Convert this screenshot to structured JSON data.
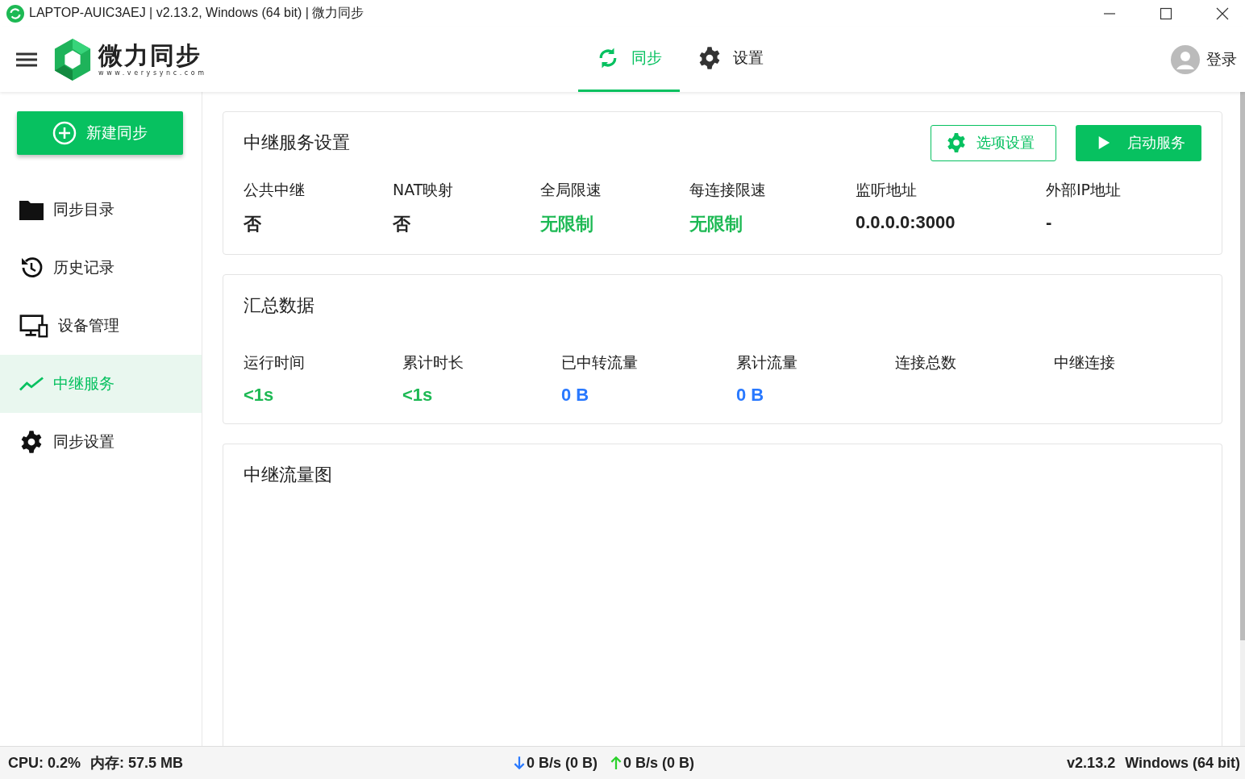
{
  "window": {
    "title": "LAPTOP-AUIC3AEJ | v2.13.2, Windows (64 bit) | 微力同步"
  },
  "logo": {
    "name": "微力同步",
    "url": "www.verysync.com"
  },
  "tabs": [
    {
      "label": "同步",
      "kind": "sync",
      "selected": true
    },
    {
      "label": "设置",
      "kind": "gear",
      "selected": false
    }
  ],
  "login": "登录",
  "new_button": "新建同步",
  "sidebar": [
    {
      "label": "同步目录",
      "kind": "folder",
      "selected": false
    },
    {
      "label": "历史记录",
      "kind": "history",
      "selected": false
    },
    {
      "label": "设备管理",
      "kind": "device",
      "selected": false
    },
    {
      "label": "中继服务",
      "kind": "chart",
      "selected": true
    },
    {
      "label": "同步设置",
      "kind": "gear",
      "selected": false
    }
  ],
  "relay_settings": {
    "title": "中继服务设置",
    "buttons": [
      {
        "label": "选项设置",
        "kind": "outline"
      },
      {
        "label": "启动服务",
        "kind": "solid"
      }
    ],
    "stats": [
      {
        "label": "公共中继",
        "value": "否",
        "color": "#222222"
      },
      {
        "label": "NAT映射",
        "value": "否",
        "color": "#222222"
      },
      {
        "label": "全局限速",
        "value": "无限制",
        "color": "#1db954"
      },
      {
        "label": "每连接限速",
        "value": "无限制",
        "color": "#1db954"
      },
      {
        "label": "监听地址",
        "value": "0.0.0.0:3000",
        "color": "#222222"
      },
      {
        "label": "外部IP地址",
        "value": "-",
        "color": "#222222"
      }
    ]
  },
  "summary": {
    "title": "汇总数据",
    "stats": [
      {
        "label": "运行时间",
        "value": "<1s",
        "color": "#1db954"
      },
      {
        "label": "累计时长",
        "value": "<1s",
        "color": "#1db954"
      },
      {
        "label": "已中转流量",
        "value": "0 B",
        "color": "#2979ff"
      },
      {
        "label": "累计流量",
        "value": "0 B",
        "color": "#2979ff"
      },
      {
        "label": "连接总数"
      },
      {
        "label": "中继连接"
      }
    ]
  },
  "traffic_chart": {
    "title": "中继流量图"
  },
  "status_bar": {
    "cpu": "CPU: 0.2%",
    "memory": "内存: 57.5 MB",
    "down": "0 B/s (0 B)",
    "up": "0 B/s (0 B)",
    "version": "v2.13.2",
    "os": "Windows (64 bit)"
  }
}
